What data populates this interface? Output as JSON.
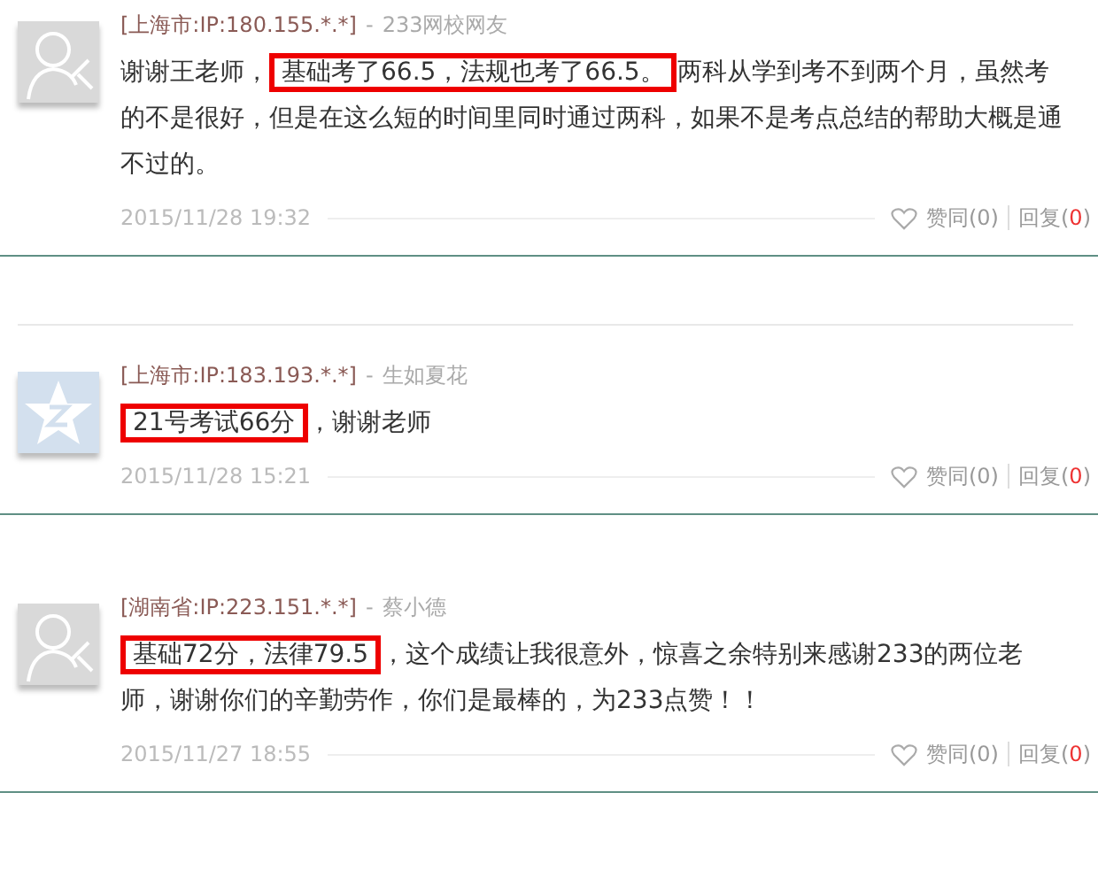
{
  "comments": [
    {
      "rule_above": false,
      "avatar": {
        "kind": "person"
      },
      "location": "[上海市:IP:180.155.*.*]",
      "separator": "-",
      "author": "233网校网友",
      "body": [
        {
          "text": "谢谢王老师，",
          "highlighted": false
        },
        {
          "text": "基础考了66.5，法规也考了66.5。",
          "highlighted": true
        },
        {
          "text": "两科从学到考不到两个月，虽然考的不是很好，但是在这么短的时间里同时通过两科，如果不是考点总结的帮助大概是通不过的。",
          "highlighted": false
        }
      ],
      "date": "2015/11/28 19:32",
      "like_label": "赞同",
      "like_count": "(0)",
      "reply_label": "回复(",
      "reply_count": "0",
      "reply_close": ")"
    },
    {
      "rule_above": true,
      "avatar": {
        "kind": "star"
      },
      "location": "[上海市:IP:183.193.*.*]",
      "separator": "-",
      "author": "生如夏花",
      "body": [
        {
          "text": "21号考试66分",
          "highlighted": true
        },
        {
          "text": "，谢谢老师",
          "highlighted": false
        }
      ],
      "date": "2015/11/28 15:21",
      "like_label": "赞同",
      "like_count": "(0)",
      "reply_label": "回复(",
      "reply_count": "0",
      "reply_close": ")"
    },
    {
      "rule_above": false,
      "avatar": {
        "kind": "person"
      },
      "location": "[湖南省:IP:223.151.*.*]",
      "separator": "-",
      "author": "蔡小德",
      "body": [
        {
          "text": "基础72分，法律79.5",
          "highlighted": true
        },
        {
          "text": "，这个成绩让我很意外，惊喜之余特别来感谢233的两位老师，谢谢你们的辛勤劳作，你们是最棒的，为233点赞！！",
          "highlighted": false
        }
      ],
      "date": "2015/11/27 18:55",
      "like_label": "赞同",
      "like_count": "(0)",
      "reply_label": "回复(",
      "reply_count": "0",
      "reply_close": ")"
    }
  ]
}
